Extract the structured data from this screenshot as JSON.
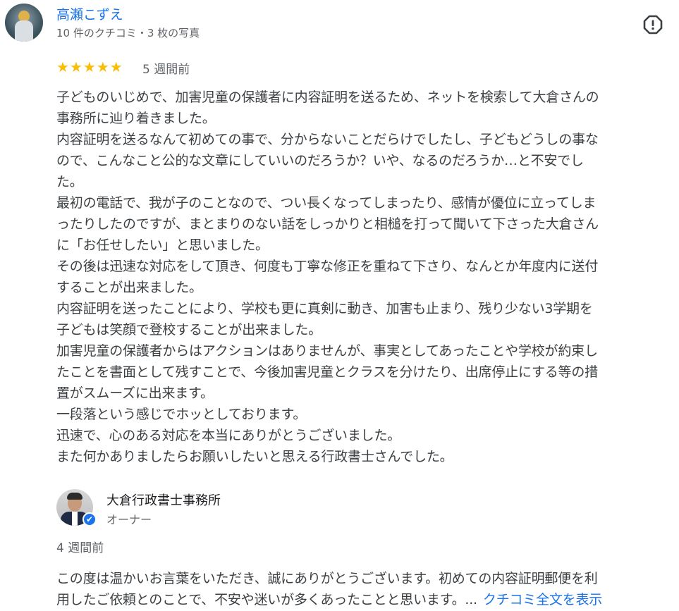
{
  "review": {
    "author_name": "高瀬こずえ",
    "author_meta": "10 件のクチコミ・3 枚の写真",
    "rating": 5,
    "stars": [
      "★",
      "★",
      "★",
      "★",
      "★"
    ],
    "relative_time": "5 週間前",
    "report_icon": "report-flag-icon",
    "text_lines": [
      "子どものいじめで、加害児童の保護者に内容証明を送るため、ネットを検索して大倉さんの",
      "事務所に辿り着きました。",
      "内容証明を送るなんて初めての事で、分からないことだらけでしたし、子どもどうしの事な",
      "ので、こんなこと公的な文章にしていいのだろうか？いや、なるのだろうか…と不安でし",
      "た。",
      "最初の電話で、我が子のことなので、つい長くなってしまったり、感情が優位に立ってしま",
      "ったりしたのですが、まとまりのない話をしっかりと相槌を打って聞いて下さった大倉さん",
      "に「お任せしたい」と思いました。",
      "その後は迅速な対応をして頂き、何度も丁寧な修正を重ねて下さり、なんとか年度内に送付",
      "することが出来ました。",
      "内容証明を送ったことにより、学校も更に真剣に動き、加害も止まり、残り少ない3学期を",
      "子どもは笑顔で登校することが出来ました。",
      "加害児童の保護者からはアクションはありませんが、事実としてあったことや学校が約束し",
      "たことを書面として残すことで、今後加害児童とクラスを分けたり、出席停止にする等の措",
      "置がスムーズに出来ます。",
      "一段落という感じでホッとしております。",
      "迅速で、心のある対応を本当にありがとうございました。",
      "また何かありましたらお願いしたいと思える行政書士さんでした。"
    ]
  },
  "owner_reply": {
    "owner_name": "大倉行政書士事務所",
    "owner_role": "オーナー",
    "verified_icon": "✔",
    "relative_time": "4 週間前",
    "text_lines": [
      "この度は温かいお言葉をいただき、誠にありがとうございます。初めての内容証明郵便を利",
      "用したご依頼とのことで、不安や迷いが多くあったことと思います。..."
    ],
    "more_link": "クチコミ全文を表示"
  },
  "colors": {
    "accent_link": "#1a73e8",
    "star": "#fbbc04",
    "secondary_text": "#5f6368"
  }
}
